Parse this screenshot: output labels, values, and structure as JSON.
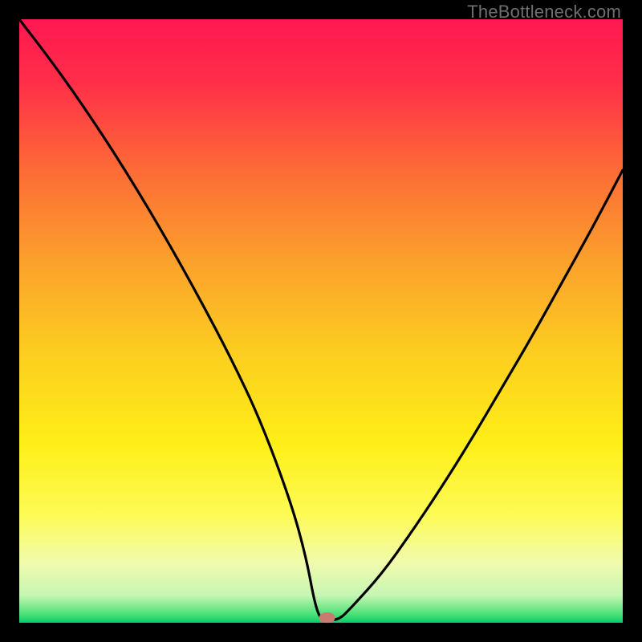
{
  "watermark": "TheBottleneck.com",
  "chart_data": {
    "type": "line",
    "title": "",
    "xlabel": "",
    "ylabel": "",
    "xlim": [
      0,
      100
    ],
    "ylim": [
      0,
      100
    ],
    "grid": false,
    "legend": false,
    "series": [
      {
        "name": "bottleneck-curve",
        "x": [
          0,
          5,
          10,
          15,
          20,
          25,
          30,
          35,
          40,
          45,
          47.5,
          49,
          50,
          51,
          53,
          55,
          60,
          65,
          70,
          75,
          80,
          85,
          90,
          95,
          100
        ],
        "y": [
          100,
          93.5,
          86.5,
          79,
          71,
          62.5,
          53.5,
          44,
          33.5,
          20,
          11,
          3,
          0.5,
          0.5,
          0.5,
          2.5,
          8,
          15,
          22.5,
          30.5,
          39,
          47.5,
          56.5,
          65.5,
          75
        ],
        "color": "#000000"
      }
    ],
    "marker": {
      "name": "optimal-point",
      "x": 51,
      "y": 0.8,
      "color": "#cb7a72",
      "shape": "ellipse"
    },
    "background_gradient": {
      "stops": [
        {
          "offset": 0.0,
          "color": "#ff1851"
        },
        {
          "offset": 0.1,
          "color": "#ff2d49"
        },
        {
          "offset": 0.25,
          "color": "#fd6b36"
        },
        {
          "offset": 0.4,
          "color": "#fca02c"
        },
        {
          "offset": 0.55,
          "color": "#fccd20"
        },
        {
          "offset": 0.7,
          "color": "#feee17"
        },
        {
          "offset": 0.82,
          "color": "#fdfb55"
        },
        {
          "offset": 0.9,
          "color": "#f1fbac"
        },
        {
          "offset": 0.955,
          "color": "#c6f6b4"
        },
        {
          "offset": 0.985,
          "color": "#4ee278"
        },
        {
          "offset": 1.0,
          "color": "#08cc6b"
        }
      ]
    }
  }
}
